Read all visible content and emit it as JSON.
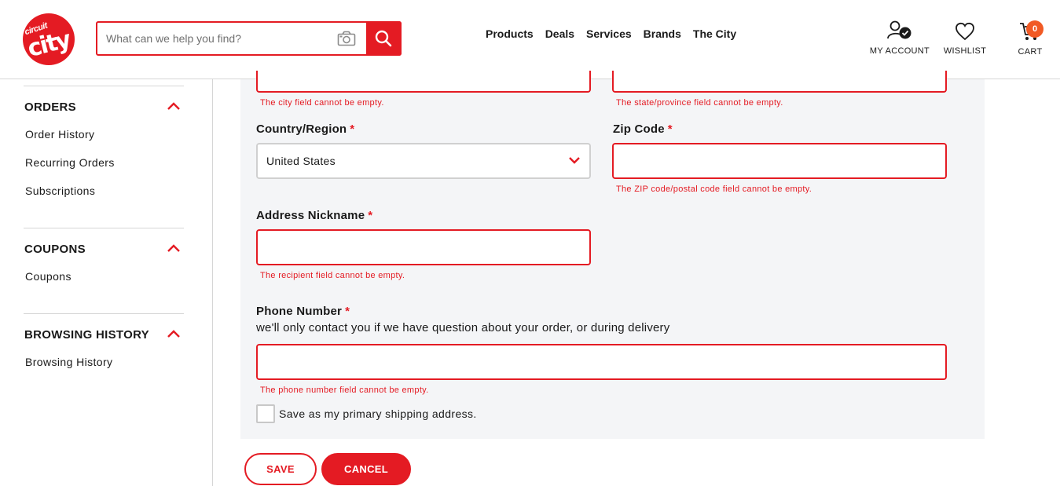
{
  "header": {
    "logo": {
      "line1": "circuit",
      "line2": "city"
    },
    "search": {
      "placeholder": "What can we help you find?"
    },
    "nav": [
      "Products",
      "Deals",
      "Services",
      "Brands",
      "The City"
    ],
    "account_label": "MY ACCOUNT",
    "wishlist_label": "WISHLIST",
    "cart_label": "CART",
    "cart_count": "0",
    "icons": [
      "camera-icon",
      "search-icon",
      "account-icon",
      "heart-icon",
      "cart-icon"
    ]
  },
  "sidebar": {
    "sections": [
      {
        "title": "ORDERS",
        "items": [
          "Order History",
          "Recurring Orders",
          "Subscriptions"
        ]
      },
      {
        "title": "COUPONS",
        "items": [
          "Coupons"
        ]
      },
      {
        "title": "BROWSING HISTORY",
        "items": [
          "Browsing History"
        ]
      }
    ]
  },
  "form": {
    "city_error": "The city field cannot be empty.",
    "state_error": "The state/province field cannot be empty.",
    "country_label": "Country/Region",
    "country_value": "United States",
    "zip_label": "Zip Code",
    "zip_error": "The ZIP code/postal code field cannot be empty.",
    "nickname_label": "Address Nickname",
    "nickname_error": "The recipient field cannot be empty.",
    "phone_label": "Phone Number",
    "phone_helper": "we'll only contact you if we have question about your order, or during delivery",
    "phone_error": "The phone number field cannot be empty.",
    "primary_checkbox_label": "Save as my primary shipping address.",
    "primary_checked": false,
    "required_marker": "*"
  },
  "actions": {
    "save": "SAVE",
    "cancel": "CANCEL"
  },
  "colors": {
    "accent": "#e41b23",
    "badge": "#f15a24",
    "form_bg": "#f4f5f7"
  }
}
